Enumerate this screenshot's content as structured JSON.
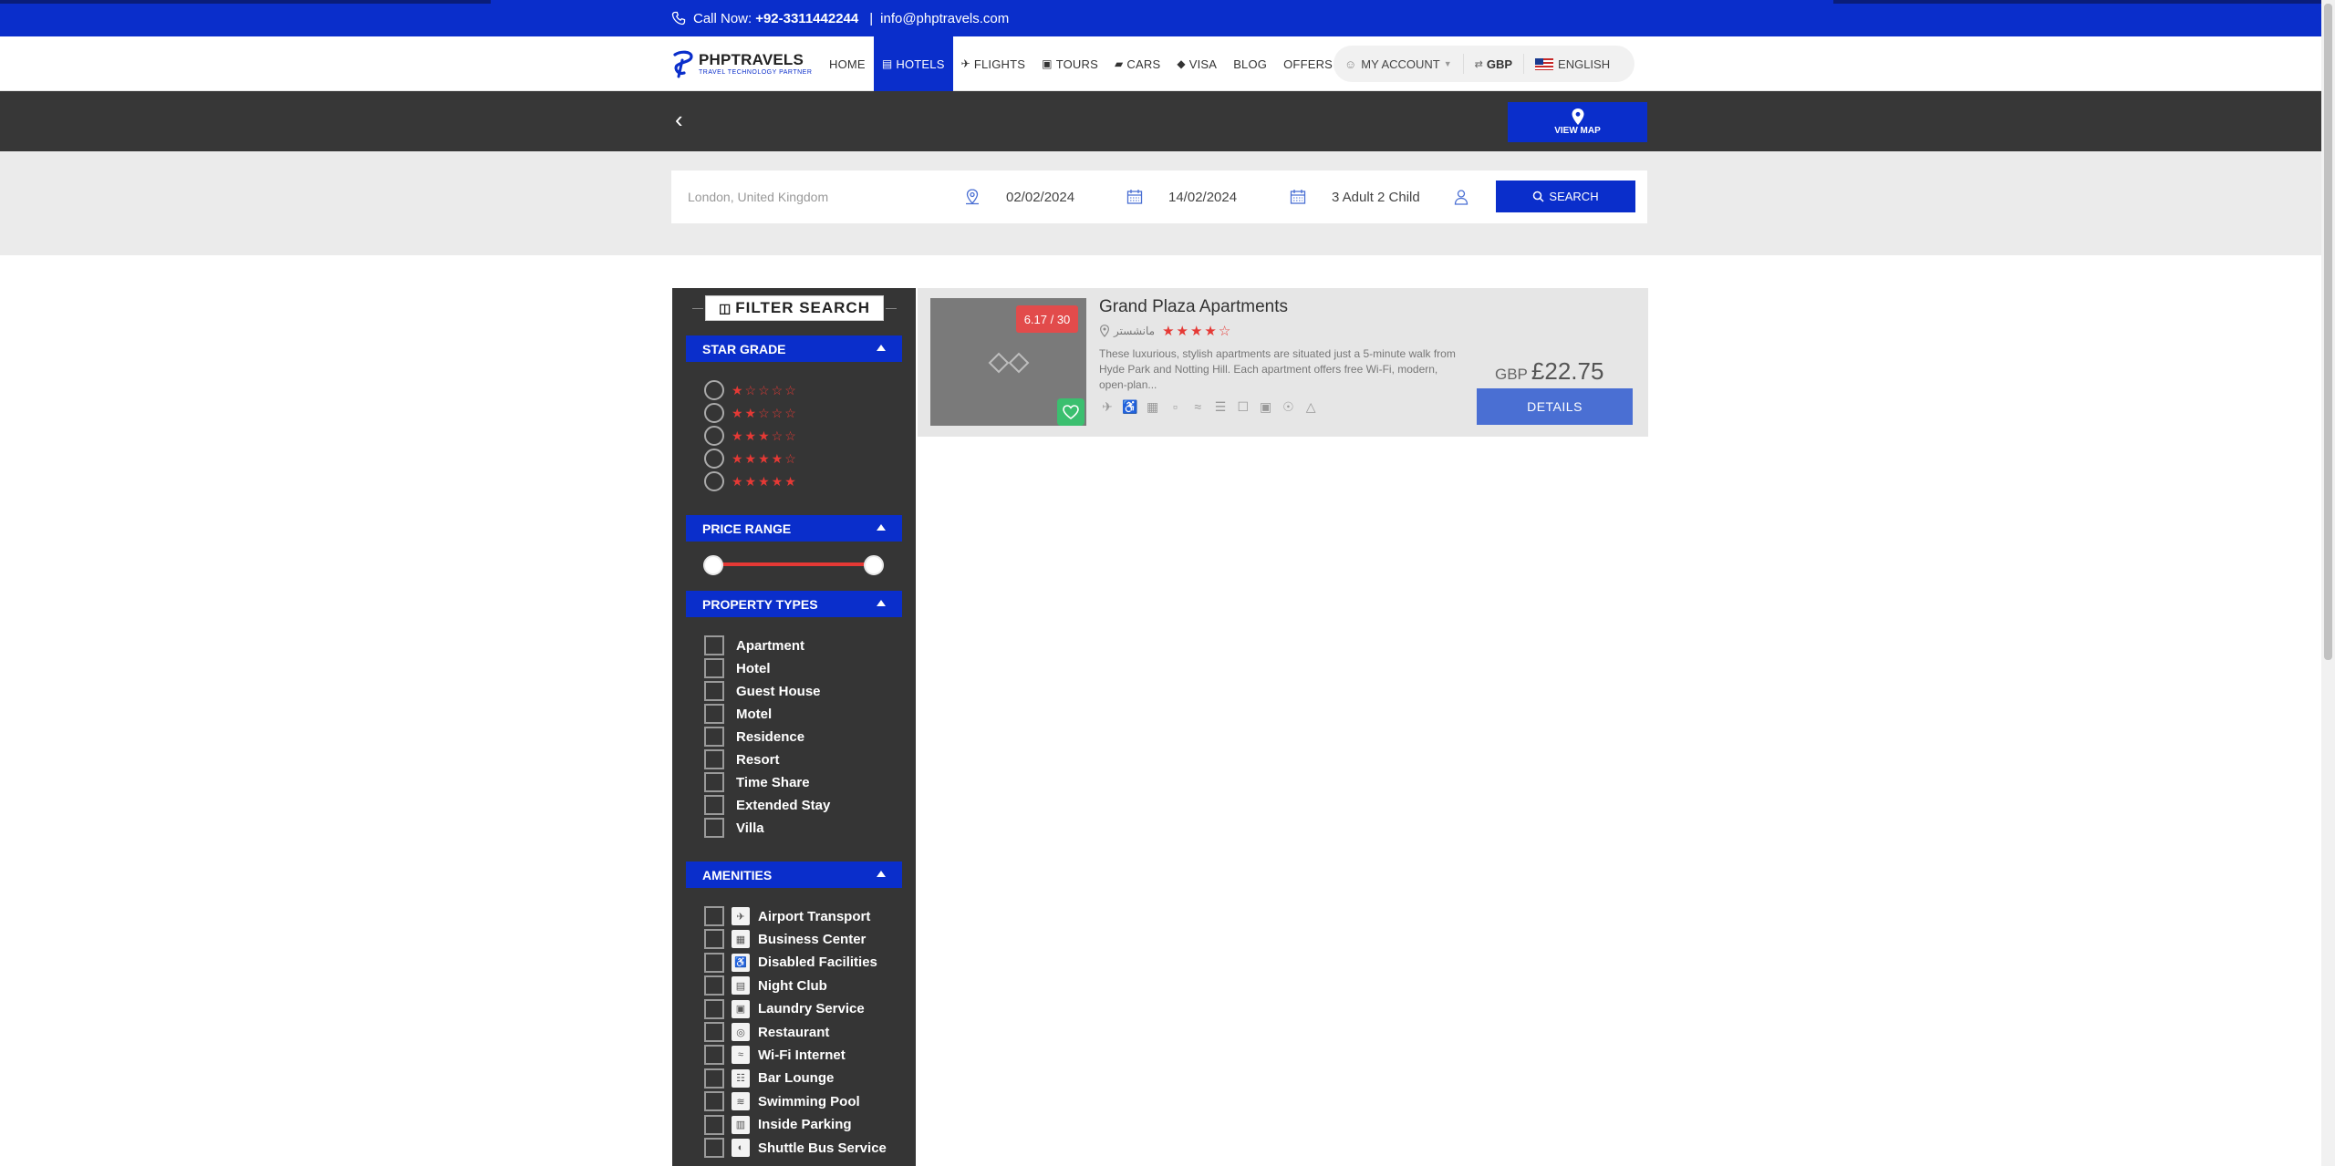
{
  "topbar": {
    "call_label": "Call Now:",
    "phone": "+92-3311442244",
    "separator": "|",
    "email": "info@phptravels.com"
  },
  "logo": {
    "name": "PHPTRAVELS",
    "tagline": "TRAVEL TECHNOLOGY PARTNER"
  },
  "nav": {
    "items": [
      {
        "label": "HOME",
        "icon": ""
      },
      {
        "label": "HOTELS",
        "icon": "hotel-icon"
      },
      {
        "label": "FLIGHTS",
        "icon": "plane-icon"
      },
      {
        "label": "TOURS",
        "icon": "suitcase-icon"
      },
      {
        "label": "CARS",
        "icon": "car-icon"
      },
      {
        "label": "VISA",
        "icon": "tag-icon"
      },
      {
        "label": "BLOG",
        "icon": ""
      },
      {
        "label": "OFFERS",
        "icon": ""
      }
    ],
    "active": "HOTELS",
    "account": "MY ACCOUNT",
    "currency": "GBP",
    "language": "ENGLISH"
  },
  "map_button": {
    "label": "VIEW MAP"
  },
  "search": {
    "location": "London, United Kingdom",
    "checkin": "02/02/2024",
    "checkout": "14/02/2024",
    "guests": "3 Adult 2 Child",
    "button": "SEARCH"
  },
  "sidebar": {
    "title": "FILTER SEARCH",
    "star_grade": {
      "label": "STAR GRADE",
      "options": [
        1,
        2,
        3,
        4,
        5
      ]
    },
    "price_range": {
      "label": "PRICE RANGE"
    },
    "property_types": {
      "label": "PROPERTY TYPES",
      "items": [
        "Apartment",
        "Hotel",
        "Guest House",
        "Motel",
        "Residence",
        "Resort",
        "Time Share",
        "Extended Stay",
        "Villa"
      ]
    },
    "amenities": {
      "label": "AMENITIES",
      "items": [
        "Airport Transport",
        "Business Center",
        "Disabled Facilities",
        "Night Club",
        "Laundry Service",
        "Restaurant",
        "Wi-Fi Internet",
        "Bar Lounge",
        "Swimming Pool",
        "Inside Parking",
        "Shuttle Bus Service"
      ]
    }
  },
  "result": {
    "name": "Grand Plaza Apartments",
    "rating_badge": "6.17 / 30",
    "location": "مانشستر",
    "stars": 4,
    "description": "These luxurious, stylish apartments are situated just a 5-minute walk from Hyde Park and Notting Hill. Each apartment offers free Wi-Fi, modern, open-plan...",
    "currency": "GBP",
    "price": "£22.75",
    "details_button": "DETAILS"
  },
  "colors": {
    "brand": "#0a2ecb",
    "accent_red": "#e53935",
    "dark_band": "#373737",
    "fav_green": "#3bbf6f"
  }
}
